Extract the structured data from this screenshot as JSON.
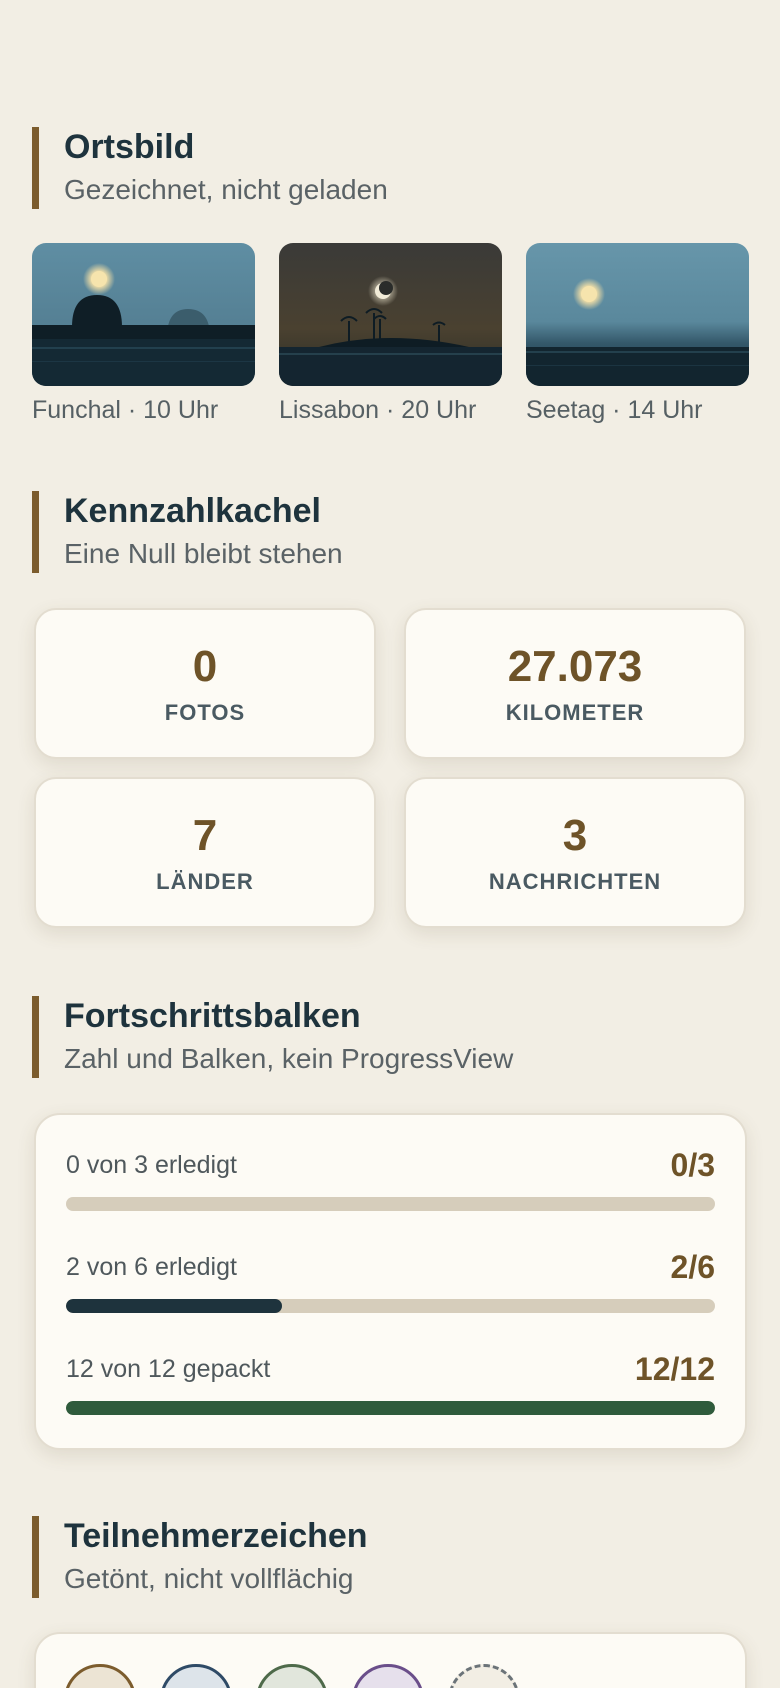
{
  "sections": {
    "ortsbild": {
      "title": "Ortsbild",
      "subtitle": "Gezeichnet, nicht geladen"
    },
    "kennzahl": {
      "title": "Kennzahlkachel",
      "subtitle": "Eine Null bleibt stehen"
    },
    "fortschritt": {
      "title": "Fortschrittsbalken",
      "subtitle": "Zahl und Balken, kein ProgressView"
    },
    "teilnehmer": {
      "title": "Teilnehmerzeichen",
      "subtitle": "Getönt, nicht vollflächig"
    }
  },
  "scenes": [
    {
      "caption": "Funchal · 10 Uhr"
    },
    {
      "caption": "Lissabon · 20 Uhr"
    },
    {
      "caption": "Seetag · 14 Uhr"
    }
  ],
  "tiles": [
    {
      "value": "0",
      "label": "FOTOS"
    },
    {
      "value": "27.073",
      "label": "KILOMETER"
    },
    {
      "value": "7",
      "label": "LÄNDER"
    },
    {
      "value": "3",
      "label": "NACHRICHTEN"
    }
  ],
  "progress": [
    {
      "label": "0 von 3 erledigt",
      "count": "0/3",
      "fraction": 0.0,
      "color": "#1e333d"
    },
    {
      "label": "2 von 6 erledigt",
      "count": "2/6",
      "fraction": 0.3333,
      "color": "#1e333d"
    },
    {
      "label": "12 von 12 gepackt",
      "count": "12/12",
      "fraction": 1.0,
      "color": "#2f5b3c"
    }
  ],
  "avatars": [
    {
      "color": "#7c5c2d",
      "bg": "#ece4d4"
    },
    {
      "color": "#2e4a66",
      "bg": "#dde4ea"
    },
    {
      "color": "#4e6a4a",
      "bg": "#e1e6dc"
    },
    {
      "color": "#6a4e8a",
      "bg": "#e6e0ec"
    },
    {
      "color": "#6b7378",
      "bg": "#f2eee4",
      "more": true
    }
  ],
  "colors": {
    "accent": "#7c5c2d",
    "background": "#f2eee4",
    "card": "#fdfbf5"
  }
}
